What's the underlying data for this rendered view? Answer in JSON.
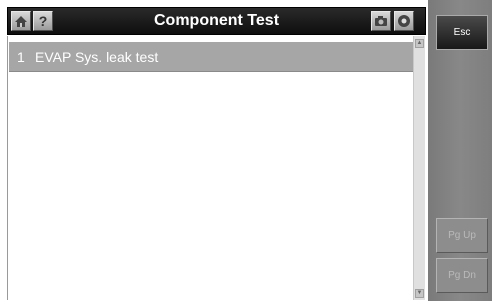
{
  "header": {
    "title": "Component Test",
    "help_glyph": "?",
    "left_icons": [
      "home-icon",
      "help-icon"
    ],
    "right_icons": [
      "camera-icon",
      "record-icon"
    ]
  },
  "list": {
    "items": [
      {
        "number": "1",
        "label": "EVAP Sys. leak test",
        "selected": true
      }
    ]
  },
  "sidebar": {
    "esc_label": "Esc",
    "pgup_label": "Pg Up",
    "pgdn_label": "Pg Dn"
  },
  "colors": {
    "titlebar": "#111111",
    "selected_row": "#a6a6a6",
    "sidepanel": "#858585",
    "disabled_text": "#b9b9b9"
  }
}
